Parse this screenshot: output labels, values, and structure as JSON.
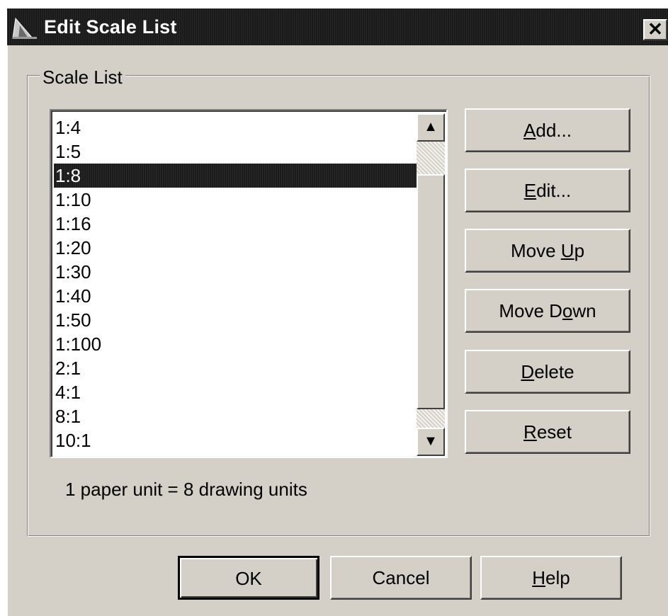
{
  "window": {
    "title": "Edit Scale List",
    "close_glyph": "✕"
  },
  "group": {
    "label": "Scale List"
  },
  "scale_list": {
    "items": [
      "1:4",
      "1:5",
      "1:8",
      "1:10",
      "1:16",
      "1:20",
      "1:30",
      "1:40",
      "1:50",
      "1:100",
      "2:1",
      "4:1",
      "8:1",
      "10:1"
    ],
    "selected_index": 2
  },
  "scrollbar": {
    "up_glyph": "▲",
    "down_glyph": "▼"
  },
  "buttons": {
    "add": {
      "pre": "",
      "mnemonic": "A",
      "post": "dd..."
    },
    "edit": {
      "pre": "",
      "mnemonic": "E",
      "post": "dit..."
    },
    "move_up": {
      "pre": "Move ",
      "mnemonic": "U",
      "post": "p"
    },
    "move_down": {
      "pre": "Move D",
      "mnemonic": "o",
      "post": "wn"
    },
    "delete": {
      "pre": "",
      "mnemonic": "D",
      "post": "elete"
    },
    "reset": {
      "pre": "",
      "mnemonic": "R",
      "post": "eset"
    },
    "ok": {
      "label": "OK"
    },
    "cancel": {
      "label": "Cancel"
    },
    "help": {
      "pre": "",
      "mnemonic": "H",
      "post": "elp"
    }
  },
  "info": {
    "text": "1 paper unit = 8 drawing units"
  },
  "colors": {
    "face": "#d4d0c8",
    "titlebar": "#1a1a1a",
    "selection": "#1a1a1a"
  }
}
